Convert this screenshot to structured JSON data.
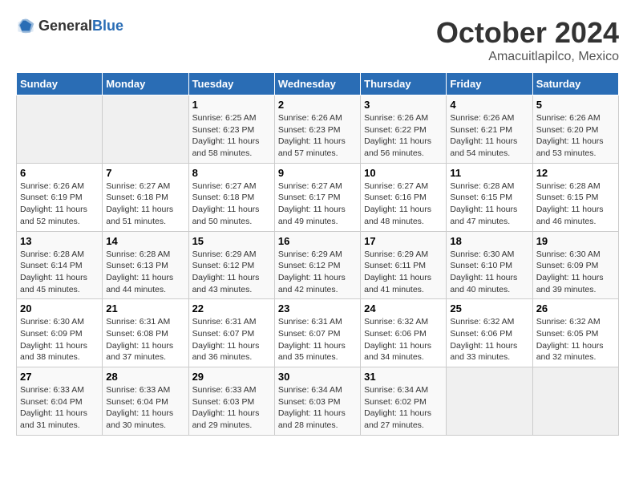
{
  "header": {
    "logo_general": "General",
    "logo_blue": "Blue",
    "title": "October 2024",
    "subtitle": "Amacuitlapilco, Mexico"
  },
  "calendar": {
    "days_of_week": [
      "Sunday",
      "Monday",
      "Tuesday",
      "Wednesday",
      "Thursday",
      "Friday",
      "Saturday"
    ],
    "weeks": [
      [
        {
          "day": "",
          "sunrise": "",
          "sunset": "",
          "daylight": "",
          "empty": true
        },
        {
          "day": "",
          "sunrise": "",
          "sunset": "",
          "daylight": "",
          "empty": true
        },
        {
          "day": "1",
          "sunrise": "Sunrise: 6:25 AM",
          "sunset": "Sunset: 6:23 PM",
          "daylight": "Daylight: 11 hours and 58 minutes."
        },
        {
          "day": "2",
          "sunrise": "Sunrise: 6:26 AM",
          "sunset": "Sunset: 6:23 PM",
          "daylight": "Daylight: 11 hours and 57 minutes."
        },
        {
          "day": "3",
          "sunrise": "Sunrise: 6:26 AM",
          "sunset": "Sunset: 6:22 PM",
          "daylight": "Daylight: 11 hours and 56 minutes."
        },
        {
          "day": "4",
          "sunrise": "Sunrise: 6:26 AM",
          "sunset": "Sunset: 6:21 PM",
          "daylight": "Daylight: 11 hours and 54 minutes."
        },
        {
          "day": "5",
          "sunrise": "Sunrise: 6:26 AM",
          "sunset": "Sunset: 6:20 PM",
          "daylight": "Daylight: 11 hours and 53 minutes."
        }
      ],
      [
        {
          "day": "6",
          "sunrise": "Sunrise: 6:26 AM",
          "sunset": "Sunset: 6:19 PM",
          "daylight": "Daylight: 11 hours and 52 minutes."
        },
        {
          "day": "7",
          "sunrise": "Sunrise: 6:27 AM",
          "sunset": "Sunset: 6:18 PM",
          "daylight": "Daylight: 11 hours and 51 minutes."
        },
        {
          "day": "8",
          "sunrise": "Sunrise: 6:27 AM",
          "sunset": "Sunset: 6:18 PM",
          "daylight": "Daylight: 11 hours and 50 minutes."
        },
        {
          "day": "9",
          "sunrise": "Sunrise: 6:27 AM",
          "sunset": "Sunset: 6:17 PM",
          "daylight": "Daylight: 11 hours and 49 minutes."
        },
        {
          "day": "10",
          "sunrise": "Sunrise: 6:27 AM",
          "sunset": "Sunset: 6:16 PM",
          "daylight": "Daylight: 11 hours and 48 minutes."
        },
        {
          "day": "11",
          "sunrise": "Sunrise: 6:28 AM",
          "sunset": "Sunset: 6:15 PM",
          "daylight": "Daylight: 11 hours and 47 minutes."
        },
        {
          "day": "12",
          "sunrise": "Sunrise: 6:28 AM",
          "sunset": "Sunset: 6:15 PM",
          "daylight": "Daylight: 11 hours and 46 minutes."
        }
      ],
      [
        {
          "day": "13",
          "sunrise": "Sunrise: 6:28 AM",
          "sunset": "Sunset: 6:14 PM",
          "daylight": "Daylight: 11 hours and 45 minutes."
        },
        {
          "day": "14",
          "sunrise": "Sunrise: 6:28 AM",
          "sunset": "Sunset: 6:13 PM",
          "daylight": "Daylight: 11 hours and 44 minutes."
        },
        {
          "day": "15",
          "sunrise": "Sunrise: 6:29 AM",
          "sunset": "Sunset: 6:12 PM",
          "daylight": "Daylight: 11 hours and 43 minutes."
        },
        {
          "day": "16",
          "sunrise": "Sunrise: 6:29 AM",
          "sunset": "Sunset: 6:12 PM",
          "daylight": "Daylight: 11 hours and 42 minutes."
        },
        {
          "day": "17",
          "sunrise": "Sunrise: 6:29 AM",
          "sunset": "Sunset: 6:11 PM",
          "daylight": "Daylight: 11 hours and 41 minutes."
        },
        {
          "day": "18",
          "sunrise": "Sunrise: 6:30 AM",
          "sunset": "Sunset: 6:10 PM",
          "daylight": "Daylight: 11 hours and 40 minutes."
        },
        {
          "day": "19",
          "sunrise": "Sunrise: 6:30 AM",
          "sunset": "Sunset: 6:09 PM",
          "daylight": "Daylight: 11 hours and 39 minutes."
        }
      ],
      [
        {
          "day": "20",
          "sunrise": "Sunrise: 6:30 AM",
          "sunset": "Sunset: 6:09 PM",
          "daylight": "Daylight: 11 hours and 38 minutes."
        },
        {
          "day": "21",
          "sunrise": "Sunrise: 6:31 AM",
          "sunset": "Sunset: 6:08 PM",
          "daylight": "Daylight: 11 hours and 37 minutes."
        },
        {
          "day": "22",
          "sunrise": "Sunrise: 6:31 AM",
          "sunset": "Sunset: 6:07 PM",
          "daylight": "Daylight: 11 hours and 36 minutes."
        },
        {
          "day": "23",
          "sunrise": "Sunrise: 6:31 AM",
          "sunset": "Sunset: 6:07 PM",
          "daylight": "Daylight: 11 hours and 35 minutes."
        },
        {
          "day": "24",
          "sunrise": "Sunrise: 6:32 AM",
          "sunset": "Sunset: 6:06 PM",
          "daylight": "Daylight: 11 hours and 34 minutes."
        },
        {
          "day": "25",
          "sunrise": "Sunrise: 6:32 AM",
          "sunset": "Sunset: 6:06 PM",
          "daylight": "Daylight: 11 hours and 33 minutes."
        },
        {
          "day": "26",
          "sunrise": "Sunrise: 6:32 AM",
          "sunset": "Sunset: 6:05 PM",
          "daylight": "Daylight: 11 hours and 32 minutes."
        }
      ],
      [
        {
          "day": "27",
          "sunrise": "Sunrise: 6:33 AM",
          "sunset": "Sunset: 6:04 PM",
          "daylight": "Daylight: 11 hours and 31 minutes."
        },
        {
          "day": "28",
          "sunrise": "Sunrise: 6:33 AM",
          "sunset": "Sunset: 6:04 PM",
          "daylight": "Daylight: 11 hours and 30 minutes."
        },
        {
          "day": "29",
          "sunrise": "Sunrise: 6:33 AM",
          "sunset": "Sunset: 6:03 PM",
          "daylight": "Daylight: 11 hours and 29 minutes."
        },
        {
          "day": "30",
          "sunrise": "Sunrise: 6:34 AM",
          "sunset": "Sunset: 6:03 PM",
          "daylight": "Daylight: 11 hours and 28 minutes."
        },
        {
          "day": "31",
          "sunrise": "Sunrise: 6:34 AM",
          "sunset": "Sunset: 6:02 PM",
          "daylight": "Daylight: 11 hours and 27 minutes."
        },
        {
          "day": "",
          "sunrise": "",
          "sunset": "",
          "daylight": "",
          "empty": true
        },
        {
          "day": "",
          "sunrise": "",
          "sunset": "",
          "daylight": "",
          "empty": true
        }
      ]
    ]
  }
}
